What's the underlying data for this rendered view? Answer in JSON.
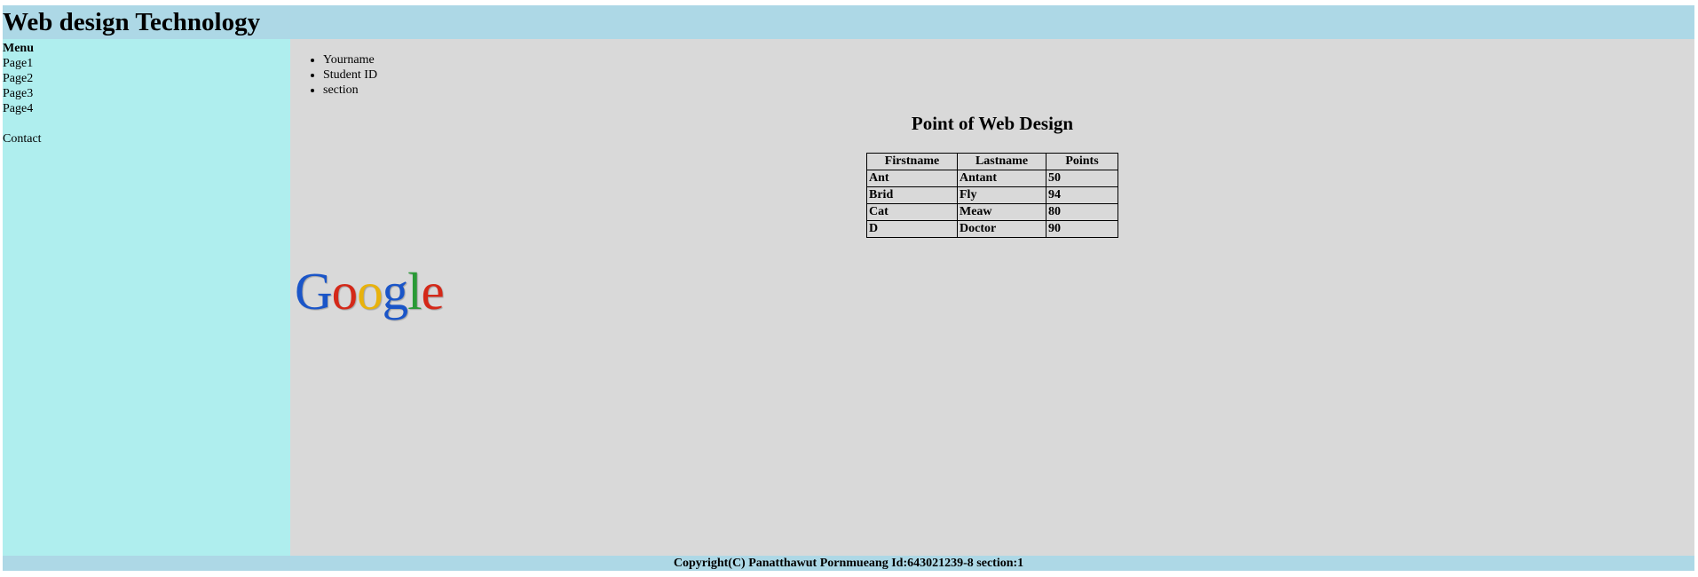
{
  "header": {
    "title": "Web design Technology"
  },
  "sidebar": {
    "menu_title": "Menu",
    "items": [
      {
        "label": "Page1"
      },
      {
        "label": "Page2"
      },
      {
        "label": "Page3"
      },
      {
        "label": "Page4"
      }
    ],
    "contact_label": "Contact"
  },
  "main": {
    "bullets": [
      "Yourname",
      "Student ID",
      "section"
    ],
    "table_title": "Point of Web Design",
    "table": {
      "headers": [
        "Firstname",
        "Lastname",
        "Points"
      ],
      "rows": [
        [
          "Ant",
          "Antant",
          "50"
        ],
        [
          "Brid",
          "Fly",
          "94"
        ],
        [
          "Cat",
          "Meaw",
          "80"
        ],
        [
          "D",
          "Doctor",
          "90"
        ]
      ]
    },
    "logo": {
      "text": "Google",
      "letters": [
        {
          "char": "G",
          "color": "#1a55c8"
        },
        {
          "char": "o",
          "color": "#d42818"
        },
        {
          "char": "o",
          "color": "#e8b20c"
        },
        {
          "char": "g",
          "color": "#1a55c8"
        },
        {
          "char": "l",
          "color": "#2a9a36"
        },
        {
          "char": "e",
          "color": "#d42818"
        }
      ]
    }
  },
  "footer": {
    "text": "Copyright(C) Panatthawut Pornmueang Id:643021239-8 section:1"
  },
  "colors": {
    "header_bg": "#add8e6",
    "sidebar_bg": "#afeeee",
    "content_bg": "#d9d9d9",
    "footer_bg": "#add8e6"
  }
}
